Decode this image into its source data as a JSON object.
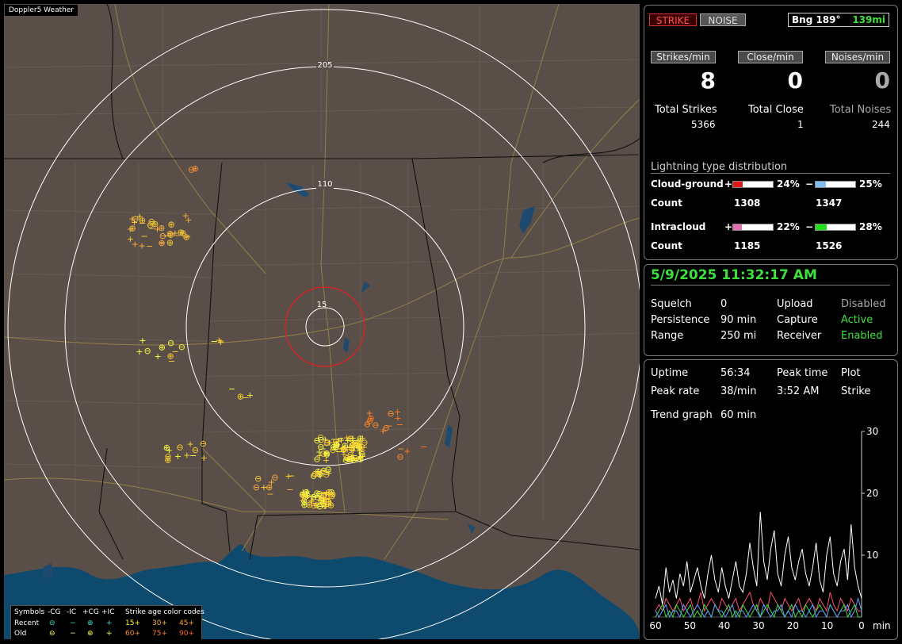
{
  "map": {
    "title": "Doppler5 Weather",
    "rings": [
      "205",
      "110",
      "15"
    ]
  },
  "legend": {
    "symbols_label": "Symbols",
    "headers": [
      "-CG",
      "-IC",
      "+CG",
      "+IC"
    ],
    "age_label": "Strike age color codes",
    "recent_label": "Recent",
    "old_label": "Old",
    "recent_ages": [
      "15+",
      "30+",
      "45+"
    ],
    "old_ages": [
      "60+",
      "75+",
      "90+"
    ],
    "colors": {
      "recent": "#ffff40",
      "mid": "#ffa030",
      "old": "#ff7a20",
      "cyan": "#40e0d0"
    }
  },
  "status": {
    "strike_btn": "STRIKE",
    "noise_btn": "NOISE",
    "bearing": "Bng 189°",
    "distance": "139mi"
  },
  "rates": {
    "strikes_label": "Strikes/min",
    "close_label": "Close/min",
    "noises_label": "Noises/min",
    "strikes": "8",
    "close": "0",
    "noises": "0"
  },
  "totals": {
    "strikes_label": "Total Strikes",
    "close_label": "Total Close",
    "noises_label": "Total Noises",
    "strikes": "5366",
    "close": "1",
    "noises": "244"
  },
  "distribution": {
    "title": "Lightning type distribution",
    "cg_label": "Cloud-ground",
    "ic_label": "Intracloud",
    "count_label": "Count",
    "plus": "+",
    "minus": "−",
    "cg_plus_pct": "24%",
    "cg_minus_pct": "25%",
    "ic_plus_pct": "22%",
    "ic_minus_pct": "28%",
    "cg_plus_count": "1308",
    "cg_minus_count": "1347",
    "ic_plus_count": "1185",
    "ic_minus_count": "1526",
    "cg_plus_frac": 0.24,
    "cg_minus_frac": 0.25,
    "ic_plus_frac": 0.22,
    "ic_minus_frac": 0.28
  },
  "info": {
    "datetime": "5/9/2025 11:32:17 AM",
    "squelch_label": "Squelch",
    "squelch": "0",
    "persistence_label": "Persistence",
    "persistence": "90 min",
    "range_label": "Range",
    "range": "250 mi",
    "upload_label": "Upload",
    "upload": "Disabled",
    "capture_label": "Capture",
    "capture": "Active",
    "receiver_label": "Receiver",
    "receiver": "Enabled"
  },
  "stats": {
    "uptime_label": "Uptime",
    "uptime": "56:34",
    "peak_time_label": "Peak time",
    "peak_time": "3:52 AM",
    "plot_label": "Plot",
    "plot": "Strike",
    "peak_rate_label": "Peak rate",
    "peak_rate": "38/min",
    "trend_label": "Trend graph",
    "trend": "60 min"
  },
  "chart_data": {
    "type": "line",
    "xlabel": "min",
    "x_ticks": [
      "60",
      "50",
      "40",
      "30",
      "20",
      "10",
      "0"
    ],
    "y_ticks": [
      "30",
      "20",
      "10"
    ],
    "ylim": [
      0,
      30
    ],
    "xlim": [
      60,
      0
    ],
    "series": [
      {
        "color": "#ffffff",
        "values": [
          3,
          5,
          2,
          8,
          4,
          6,
          3,
          7,
          5,
          9,
          4,
          6,
          8,
          5,
          3,
          7,
          10,
          6,
          4,
          8,
          5,
          3,
          6,
          9,
          5,
          4,
          7,
          12,
          8,
          5,
          17,
          9,
          6,
          11,
          14,
          7,
          5,
          10,
          13,
          8,
          6,
          9,
          11,
          7,
          5,
          8,
          12,
          6,
          4,
          10,
          13,
          7,
          5,
          9,
          11,
          6,
          15,
          8,
          5,
          3
        ]
      },
      {
        "color": "#ff5070",
        "values": [
          1,
          2,
          1,
          3,
          2,
          1,
          2,
          3,
          1,
          2,
          3,
          1,
          2,
          4,
          1,
          2,
          3,
          2,
          1,
          3,
          2,
          1,
          2,
          3,
          1,
          2,
          3,
          4,
          2,
          1,
          3,
          2,
          1,
          4,
          3,
          2,
          1,
          3,
          2,
          1,
          2,
          3,
          1,
          2,
          3,
          2,
          1,
          3,
          2,
          1,
          4,
          2,
          1,
          3,
          2,
          1,
          3,
          2,
          1,
          1
        ]
      },
      {
        "color": "#3ee03e",
        "values": [
          0,
          1,
          2,
          0,
          1,
          0,
          2,
          1,
          0,
          1,
          2,
          0,
          1,
          0,
          2,
          1,
          0,
          2,
          1,
          0,
          1,
          2,
          0,
          1,
          0,
          2,
          1,
          0,
          1,
          2,
          0,
          1,
          2,
          1,
          0,
          2,
          1,
          0,
          1,
          2,
          0,
          1,
          0,
          2,
          1,
          0,
          1,
          2,
          1,
          0,
          2,
          1,
          0,
          1,
          2,
          0,
          1,
          2,
          0,
          0
        ]
      },
      {
        "color": "#60a0ff",
        "values": [
          1,
          0,
          1,
          2,
          0,
          1,
          1,
          0,
          2,
          1,
          0,
          1,
          2,
          1,
          0,
          1,
          0,
          2,
          1,
          1,
          0,
          1,
          2,
          0,
          1,
          1,
          0,
          1,
          2,
          1,
          0,
          2,
          1,
          0,
          1,
          1,
          2,
          0,
          1,
          0,
          2,
          1,
          1,
          0,
          1,
          2,
          0,
          1,
          1,
          0,
          2,
          1,
          0,
          1,
          1,
          2,
          0,
          1,
          3,
          1
        ]
      }
    ]
  }
}
